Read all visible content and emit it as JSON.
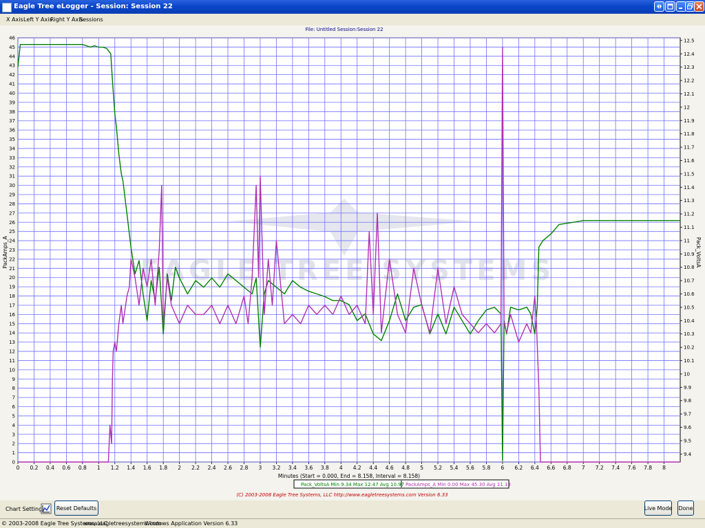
{
  "window": {
    "title": "Eagle Tree eLogger - Session: Session 22",
    "controls": [
      "restore-icon",
      "tile-icon",
      "minimize-icon",
      "maximize-icon",
      "close-icon"
    ]
  },
  "menu": [
    "X Axis",
    "Left Y Axis",
    "Right Y Axis",
    "Sessions"
  ],
  "chart_header": "File: Untitled   Session:Session 22",
  "chart_data": {
    "type": "line",
    "xlabel": "Minutes (Start = 0.000,  End = 8.158,  Interval =  8.158)",
    "ylabel_left": "PackAmps_A",
    "ylabel_right": "Pack_VoltsA",
    "xlim": [
      0,
      8.2
    ],
    "ylim_left": [
      0,
      46
    ],
    "ylim_right": [
      9.34,
      12.52
    ],
    "x_ticks": [
      "0",
      "0.2",
      "0.4",
      "0.6",
      "0.8",
      "1",
      "1.2",
      "1.4",
      "1.6",
      "1.8",
      "2",
      "2.2",
      "2.4",
      "2.6",
      "2.8",
      "3",
      "3.2",
      "3.4",
      "3.6",
      "3.8",
      "4",
      "4.2",
      "4.4",
      "4.6",
      "4.8",
      "5",
      "5.2",
      "5.4",
      "5.6",
      "5.8",
      "6",
      "6.2",
      "6.4",
      "6.6",
      "6.8",
      "7",
      "7.2",
      "7.4",
      "7.6",
      "7.8",
      "8"
    ],
    "y_left_ticks": [
      "0",
      "1",
      "2",
      "3",
      "4",
      "5",
      "6",
      "7",
      "8",
      "9",
      "10",
      "11",
      "12",
      "13",
      "14",
      "15",
      "16",
      "17",
      "18",
      "19",
      "20",
      "21",
      "22",
      "23",
      "24",
      "25",
      "26",
      "27",
      "28",
      "29",
      "30",
      "31",
      "32",
      "33",
      "34",
      "35",
      "36",
      "37",
      "38",
      "39",
      "40",
      "41",
      "42",
      "43",
      "44",
      "45",
      "46"
    ],
    "y_right_ticks": [
      "9.4",
      "9.5",
      "9.6",
      "9.7",
      "9.8",
      "9.9",
      "10",
      "10.1",
      "10.2",
      "10.3",
      "10.4",
      "10.5",
      "10.6",
      "10.7",
      "10.8",
      "10.9",
      "11",
      "11.1",
      "11.2",
      "11.3",
      "11.4",
      "11.5",
      "11.6",
      "11.7",
      "11.8",
      "11.9",
      "12",
      "12.1",
      "12.2",
      "12.3",
      "12.4",
      "12.5"
    ],
    "grid": true,
    "series": [
      {
        "name": "Pack_VoltsA",
        "axis": "right",
        "color": "#008000",
        "x": [
          0,
          0.03,
          0.1,
          0.4,
          0.8,
          0.9,
          0.95,
          1.0,
          1.05,
          1.1,
          1.15,
          1.17,
          1.2,
          1.22,
          1.25,
          1.28,
          1.3,
          1.35,
          1.4,
          1.45,
          1.5,
          1.55,
          1.6,
          1.65,
          1.7,
          1.75,
          1.8,
          1.85,
          1.9,
          1.95,
          2.0,
          2.1,
          2.2,
          2.3,
          2.4,
          2.5,
          2.6,
          2.7,
          2.8,
          2.9,
          2.95,
          3.0,
          3.05,
          3.1,
          3.2,
          3.3,
          3.4,
          3.5,
          3.6,
          3.7,
          3.8,
          3.9,
          4.0,
          4.1,
          4.2,
          4.3,
          4.4,
          4.5,
          4.6,
          4.7,
          4.8,
          4.9,
          5.0,
          5.1,
          5.2,
          5.3,
          5.4,
          5.5,
          5.6,
          5.7,
          5.8,
          5.9,
          5.98,
          6.0,
          6.02,
          6.05,
          6.1,
          6.2,
          6.3,
          6.35,
          6.4,
          6.43,
          6.45,
          6.5,
          6.6,
          6.7,
          6.8,
          6.9,
          7.0,
          7.5,
          8.0,
          8.2
        ],
        "values": [
          12.3,
          12.47,
          12.47,
          12.47,
          12.47,
          12.45,
          12.46,
          12.45,
          12.45,
          12.44,
          12.4,
          12.2,
          11.95,
          11.85,
          11.65,
          11.5,
          11.45,
          11.2,
          10.95,
          10.75,
          10.85,
          10.6,
          10.4,
          10.7,
          10.55,
          10.8,
          10.3,
          10.75,
          10.55,
          10.8,
          10.72,
          10.6,
          10.7,
          10.65,
          10.72,
          10.65,
          10.75,
          10.7,
          10.65,
          10.6,
          10.72,
          10.2,
          10.6,
          10.7,
          10.65,
          10.6,
          10.7,
          10.65,
          10.62,
          10.6,
          10.58,
          10.55,
          10.55,
          10.52,
          10.4,
          10.45,
          10.3,
          10.25,
          10.4,
          10.6,
          10.4,
          10.5,
          10.52,
          10.3,
          10.45,
          10.3,
          10.5,
          10.4,
          10.3,
          10.4,
          10.48,
          10.5,
          10.45,
          9.35,
          10.4,
          10.3,
          10.5,
          10.48,
          10.5,
          10.45,
          10.3,
          10.5,
          10.95,
          11.0,
          11.05,
          11.12,
          11.13,
          11.14,
          11.15,
          11.15,
          11.15,
          11.15
        ]
      },
      {
        "name": "PackAmps_A",
        "axis": "left",
        "color": "#b030b0",
        "x": [
          0,
          0.3,
          0.6,
          0.8,
          0.9,
          1.0,
          1.1,
          1.12,
          1.14,
          1.16,
          1.17,
          1.18,
          1.2,
          1.22,
          1.25,
          1.28,
          1.3,
          1.35,
          1.38,
          1.4,
          1.45,
          1.5,
          1.55,
          1.6,
          1.65,
          1.7,
          1.75,
          1.78,
          1.8,
          1.85,
          1.9,
          2.0,
          2.1,
          2.2,
          2.3,
          2.4,
          2.5,
          2.6,
          2.7,
          2.8,
          2.85,
          2.9,
          2.95,
          2.98,
          3.0,
          3.05,
          3.1,
          3.15,
          3.2,
          3.3,
          3.4,
          3.5,
          3.6,
          3.7,
          3.8,
          3.9,
          4.0,
          4.1,
          4.2,
          4.3,
          4.35,
          4.4,
          4.45,
          4.5,
          4.6,
          4.7,
          4.8,
          4.9,
          5.0,
          5.1,
          5.2,
          5.3,
          5.4,
          5.5,
          5.6,
          5.7,
          5.8,
          5.9,
          5.98,
          6.0,
          6.02,
          6.05,
          6.1,
          6.2,
          6.3,
          6.35,
          6.4,
          6.42,
          6.45,
          6.47,
          6.5,
          7.0,
          7.8,
          8.2
        ],
        "values": [
          0,
          0,
          0,
          0,
          0,
          0,
          0,
          0,
          4,
          2,
          9,
          12,
          13,
          12,
          15,
          17,
          15,
          18,
          19,
          22,
          20,
          17,
          21,
          19,
          22,
          17,
          23,
          30,
          15,
          20,
          17,
          15,
          17,
          16,
          16,
          17,
          15,
          17,
          15,
          18,
          15,
          20,
          30,
          20,
          31,
          16,
          22,
          17,
          24,
          15,
          16,
          15,
          17,
          16,
          17,
          16,
          18,
          16,
          17,
          15,
          25,
          16,
          27,
          14,
          22,
          16,
          14,
          21,
          17,
          14,
          21,
          15,
          19,
          16,
          15,
          14,
          15,
          14,
          15,
          45,
          15,
          14,
          16,
          13,
          15,
          14,
          18,
          15,
          8,
          0,
          0,
          0,
          0,
          0
        ]
      }
    ],
    "legend": [
      {
        "name": "Pack_VoltsA",
        "stats": "Min 9.34   Max 12.47   Avg 10.97"
      },
      {
        "name": "PackAmps_A",
        "stats": "Min 0.00   Max 45.30   Avg 11.13"
      }
    ],
    "legend_placement": "bottom-center",
    "watermark": "EAGLE TREE SYSTEMS"
  },
  "copyright_line": "(C) 2003-2008 Eagle Tree Systems, LLC     http://www.eagletreesystems.com     Version 6.33",
  "toolbar": {
    "chart_settings_label": "Chart Settings:",
    "chart_settings_icon": "chart-settings-icon",
    "reset_defaults": "Reset Defaults",
    "live_mode": "Live Mode",
    "done": "Done"
  },
  "status": {
    "copyright": "© 2003-2008 Eagle Tree Systems, LLC",
    "website": "www.eagletreesystems.com",
    "version": "Windows Application Version 6.33"
  },
  "colors": {
    "title_bar": "#0b46c9",
    "grid": "#6e6eff",
    "volts_line": "#008000",
    "amps_line": "#b030b0",
    "copyright_text": "#c00000"
  }
}
